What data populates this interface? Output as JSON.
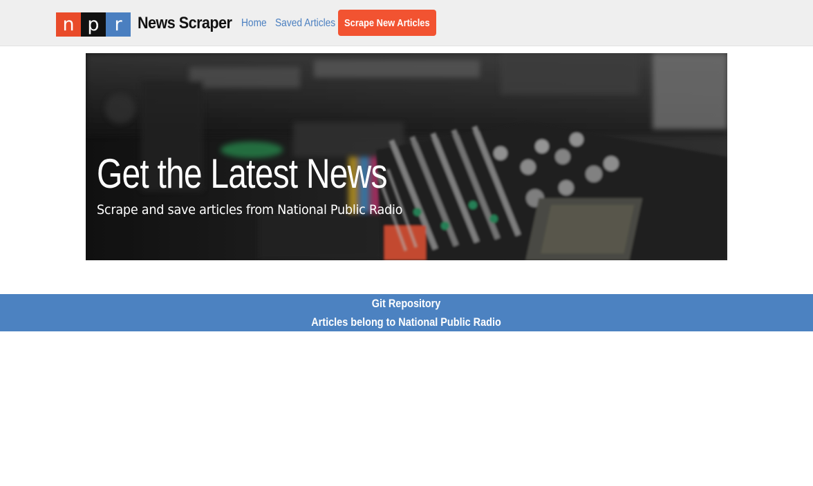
{
  "header": {
    "logo_letters": [
      "n",
      "p",
      "r"
    ],
    "logo_colors": [
      "#e94b2a",
      "#111111",
      "#4a7fc0"
    ],
    "brand": "News Scraper",
    "nav": {
      "home": "Home",
      "saved": "Saved Articles",
      "scrape_button": "Scrape New Articles"
    }
  },
  "hero": {
    "title": "Get the Latest News",
    "subtitle": "Scrape and save articles from National Public Radio",
    "image": "audio-mixing-console-photo"
  },
  "footer": {
    "repo_link": "Git Repository",
    "credit": "Articles belong to National Public Radio"
  },
  "colors": {
    "accent_orange": "#f25331",
    "accent_blue": "#4c82c1",
    "navbar_bg": "#efefef"
  }
}
